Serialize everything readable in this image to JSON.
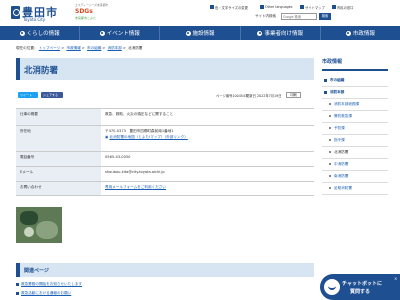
{
  "header": {
    "city_name": "豊田市",
    "city_name_en": "Toyota City",
    "sdgs_top": "エスディージーズ未来都市",
    "sdgs_mark": "SDGs",
    "sdgs_bottom": "未来都市とよた",
    "links": [
      {
        "label": "色・文字サイズの変更"
      },
      {
        "label": "Other languages"
      },
      {
        "label": "サイトマップ"
      },
      {
        "label": "市民の窓口"
      }
    ],
    "search_label": "サイト内検索",
    "search_placeholder": "Google 検索",
    "search_button": "検索"
  },
  "nav": {
    "items": [
      {
        "label": "くらしの情報"
      },
      {
        "label": "イベント情報"
      },
      {
        "label": "施設情報"
      },
      {
        "label": "事業者向け情報"
      },
      {
        "label": "市政情報"
      }
    ]
  },
  "breadcrumb": {
    "prefix": "現在の位置：",
    "items": [
      "トップページ",
      "市政情報",
      "市の組織",
      "消防本部"
    ],
    "current": "北消防署"
  },
  "main": {
    "title": "北消防署",
    "share_twitter": "ツイート",
    "share_facebook": "シェアする",
    "page_id": "ページ番号1004543",
    "updated": "更新日 2022年7月19日",
    "print": "印刷",
    "rows": [
      {
        "label": "仕事の概要",
        "value": "救急、救助、火災の鎮圧などに関すること"
      },
      {
        "label": "所在地",
        "value": "〒470-0373　豊田市四郷町森前南1番地1",
        "link": "北消防署の地図（とよたiマップ）（外部リンク）"
      },
      {
        "label": "電話番号",
        "value": "0565-43-0050"
      },
      {
        "label": "Eメール",
        "value": "shoubou-kita@city.toyota.aichi.jp"
      },
      {
        "label": "お問い合わせ",
        "link": "専用メールフォームをご利用ください"
      }
    ]
  },
  "related": {
    "title": "関連ページ",
    "items": [
      {
        "label": "救急業務の開始をお知らせいたします"
      },
      {
        "label": "救急活動における通報のお願い"
      }
    ]
  },
  "sidebar": {
    "title": "市政情報",
    "items": [
      {
        "label": "市の組織",
        "level": "head"
      },
      {
        "label": "消防本部",
        "level": "head"
      },
      {
        "label": "消防本部総務課",
        "level": "sub"
      },
      {
        "label": "警防救急課",
        "level": "sub"
      },
      {
        "label": "予防課",
        "level": "sub"
      },
      {
        "label": "指令課",
        "level": "sub"
      },
      {
        "label": "北消防署",
        "level": "sub",
        "current": true
      },
      {
        "label": "中消防署",
        "level": "sub"
      },
      {
        "label": "南消防署",
        "level": "sub"
      },
      {
        "label": "足助消防署",
        "level": "sub"
      }
    ]
  },
  "chatbot": {
    "line1": "チャットボットに",
    "line2": "質問する",
    "close": "×"
  }
}
